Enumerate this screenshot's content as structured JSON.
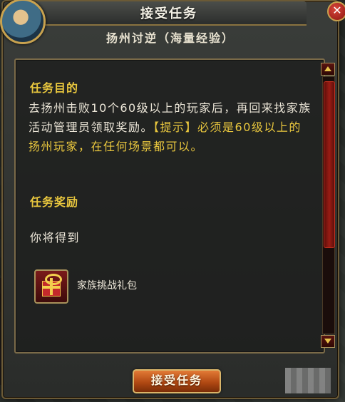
{
  "window": {
    "title": "接受任务",
    "subtitle": "扬州讨逆（海量经验）",
    "close_glyph": "✕"
  },
  "quest": {
    "objective_heading": "任务目的",
    "objective_text": "去扬州击败10个60级以上的玩家后，再回来找家族活动管理员领取奖励。",
    "tip_text": "【提示】必须是60级以上的扬州玩家，在任何场景都可以。",
    "reward_heading": "任务奖励",
    "receive_label": "你将得到",
    "reward_item": {
      "name": "家族挑战礼包",
      "icon": "gift-box-icon"
    }
  },
  "scrollbar": {
    "position": 0.05,
    "visible_fraction": 0.65
  },
  "actions": {
    "accept_label": "接受任务"
  },
  "colors": {
    "heading": "#e9c73e",
    "body_text": "#ece6d8",
    "button": "#b14913"
  }
}
